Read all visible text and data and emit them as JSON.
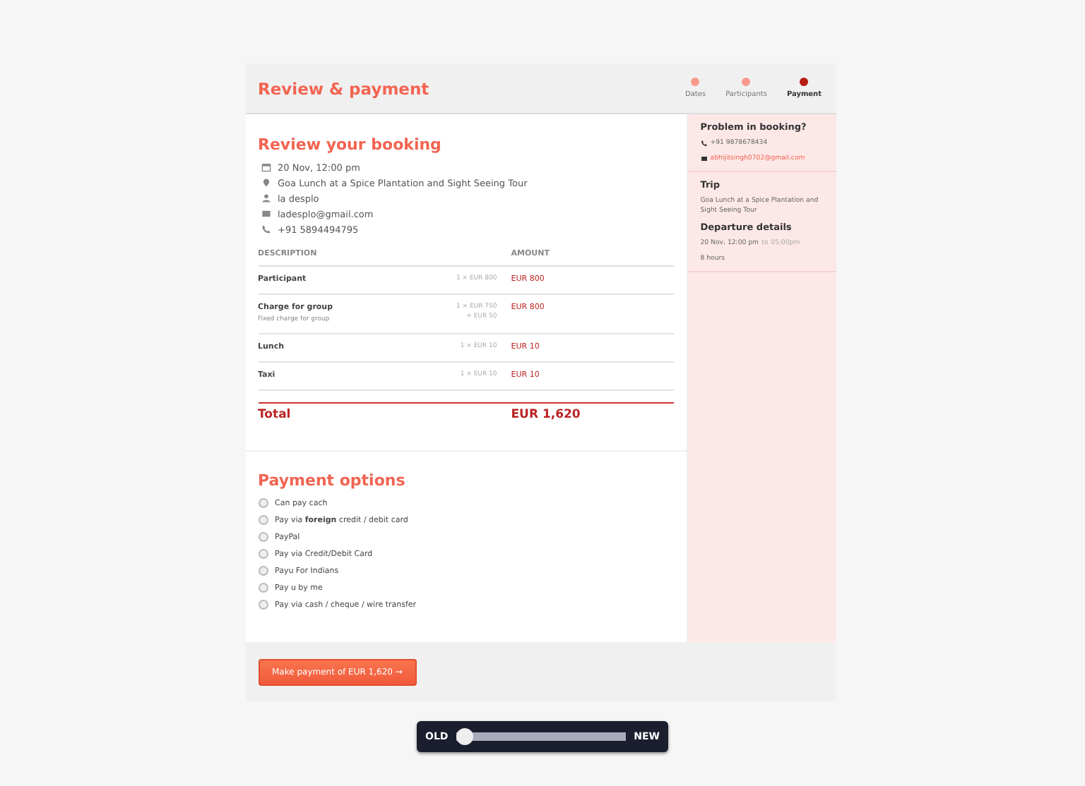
{
  "header": {
    "title": "Review & payment",
    "steps": [
      {
        "label": "Dates",
        "selected": false
      },
      {
        "label": "Participants",
        "selected": false
      },
      {
        "label": "Payment",
        "selected": true
      }
    ]
  },
  "booking": {
    "title": "Review your booking",
    "details": [
      {
        "kind": "calendar",
        "text": "20 Nov, 12:00 pm"
      },
      {
        "kind": "pin",
        "text": "Goa Lunch at a Spice Plantation and Sight Seeing Tour"
      },
      {
        "kind": "person",
        "text": "la desplo"
      },
      {
        "kind": "mail",
        "text": "ladesplo@gmail.com"
      },
      {
        "kind": "phone",
        "text": "+91 5894494795"
      }
    ],
    "columns": [
      "DESCRIPTION",
      "AMOUNT"
    ],
    "rows": [
      {
        "description": "Participant",
        "calc": "1 × EUR 800",
        "amount": "EUR 800"
      },
      {
        "description": "Charge for group",
        "note": "Fixed charge for group",
        "calc": "1 × EUR 750",
        "calc_note": "+ EUR 50",
        "amount": "EUR 800"
      },
      {
        "description": "Lunch",
        "calc": "1 × EUR 10",
        "amount": "EUR 10"
      },
      {
        "description": "Taxi",
        "calc": "1 × EUR 10",
        "amount": "EUR 10"
      }
    ],
    "total": {
      "label": "Total",
      "amount": "EUR 1,620"
    }
  },
  "payment": {
    "title": "Payment options",
    "options": [
      {
        "label": "Can pay cach",
        "selected": false
      },
      {
        "label": "Pay via **foreign** credit / debit card",
        "selected": false
      },
      {
        "label": "PayPal",
        "selected": false
      },
      {
        "label": "Pay via Credit/Debit Card",
        "selected": false
      },
      {
        "label": "Payu For Indians",
        "selected": false
      },
      {
        "label": "Pay u by me",
        "selected": false
      },
      {
        "label": "Pay via cash / cheque / wire transfer",
        "selected": false
      }
    ],
    "button": "Make payment of EUR 1,620 →"
  },
  "sidebar": {
    "help_title": "Problem in booking?",
    "phone": "+91 9878678434",
    "email": "abhijitsingh0702@gmail.com",
    "trip_title": "Trip",
    "trip": "Goa Lunch at a Spice Plantation and Sight Seeing Tour",
    "departure_title": "Departure details",
    "departure_time": "20 Nov, 12:00 pm",
    "departure_sep": "to",
    "departure_end": "05:00pm",
    "duration": "8 hours"
  },
  "compare": {
    "left": "OLD",
    "right": "NEW",
    "level": 0.0
  }
}
